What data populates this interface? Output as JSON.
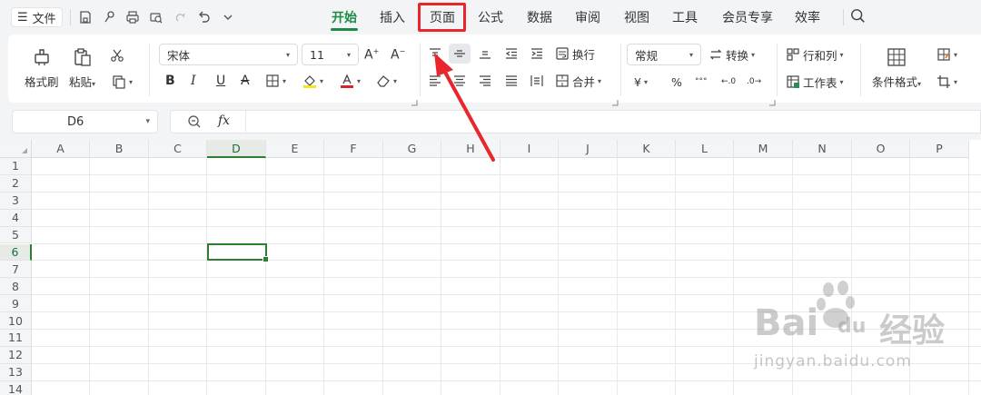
{
  "topbar": {
    "file_label": "文件",
    "tabs": [
      "开始",
      "插入",
      "页面",
      "公式",
      "数据",
      "审阅",
      "视图",
      "工具",
      "会员专享",
      "效率"
    ],
    "active_tab": "开始",
    "highlighted_tab": "页面"
  },
  "ribbon": {
    "format_painter": "格式刷",
    "paste": "粘贴",
    "font_name": "宋体",
    "font_size": "11",
    "wrap_text": "换行",
    "merge": "合并",
    "number_format": "常规",
    "convert": "转换",
    "rows_cols": "行和列",
    "worksheet": "工作表",
    "conditional_format": "条件格式",
    "currency_symbol": "¥",
    "percent_symbol": "%"
  },
  "formula_bar": {
    "cell_ref": "D6",
    "fx_label": "fx"
  },
  "grid": {
    "columns": [
      "A",
      "B",
      "C",
      "D",
      "E",
      "F",
      "G",
      "H",
      "I",
      "J",
      "K",
      "L",
      "M",
      "N",
      "O",
      "P"
    ],
    "rows": [
      "1",
      "2",
      "3",
      "4",
      "5",
      "6",
      "7",
      "8",
      "9",
      "10",
      "11",
      "12",
      "13",
      "14"
    ],
    "selected_column": "D",
    "selected_row": "6"
  },
  "watermark": {
    "brand": "Bai",
    "brand2": "du",
    "brand_cn": "经验",
    "url": "jingyan.baidu.com"
  },
  "colors": {
    "accent": "#1e8a48",
    "highlight": "#e8262c",
    "selection": "#2e7d32"
  }
}
